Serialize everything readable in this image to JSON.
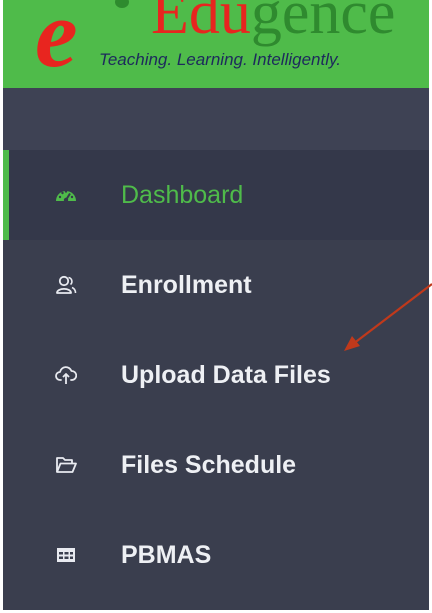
{
  "logo": {
    "letter": "e",
    "word_red": "Edu",
    "word_green": "gence",
    "tagline": "Teaching. Learning. Intelligently."
  },
  "menu": {
    "items": [
      {
        "label": "Dashboard",
        "icon": "dashboard-icon",
        "active": true
      },
      {
        "label": "Enrollment",
        "icon": "users-icon",
        "active": false
      },
      {
        "label": "Upload Data Files",
        "icon": "cloud-upload-icon",
        "active": false
      },
      {
        "label": "Files Schedule",
        "icon": "folder-open-icon",
        "active": false
      },
      {
        "label": "PBMAS",
        "icon": "table-icon",
        "active": false
      }
    ]
  },
  "colors": {
    "sidebar_bg": "#3a3e4e",
    "accent_green": "#4fbb4a",
    "logo_red": "#e8251f",
    "annotation_arrow": "#c0391b"
  }
}
